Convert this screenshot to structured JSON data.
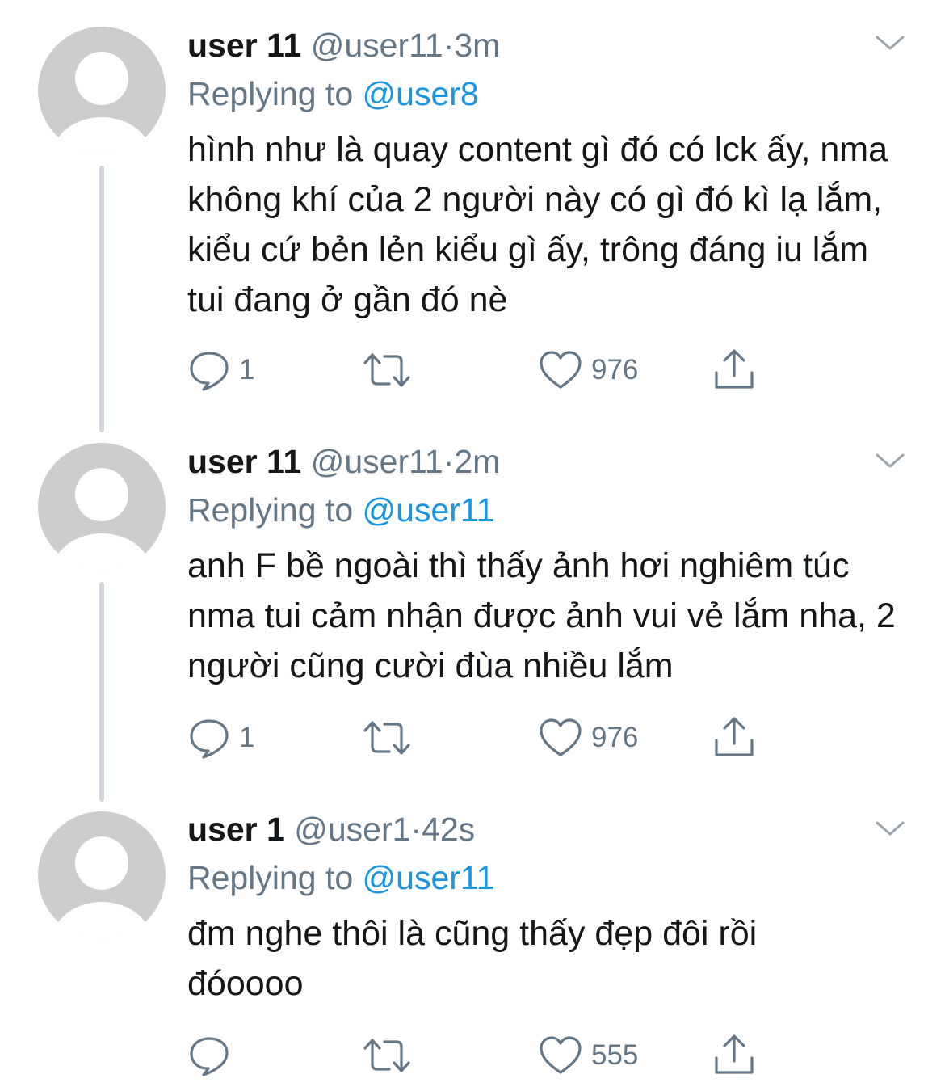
{
  "tweets": [
    {
      "name": "user 11",
      "handle": "@user11",
      "dot": "·",
      "time": "3m",
      "replying_prefix": "Replying to",
      "replying_to": "@user8",
      "text": "hình như là quay content gì đó có lck ấy, nma không khí của 2 người này có gì đó kì lạ lắm, kiểu cứ bẻn lẻn kiểu gì ấy, trông đáng iu lắm tui đang ở gần đó nè",
      "replies": "1",
      "retweets": "",
      "likes": "976"
    },
    {
      "name": "user 11",
      "handle": "@user11",
      "dot": "·",
      "time": "2m",
      "replying_prefix": "Replying to",
      "replying_to": "@user11",
      "text": "anh F bề ngoài thì thấy ảnh hơi nghiêm túc nma tui cảm nhận được ảnh vui vẻ lắm nha, 2 người cũng cười đùa nhiều lắm",
      "replies": "1",
      "retweets": "",
      "likes": "976"
    },
    {
      "name": "user 1",
      "handle": "@user1",
      "dot": "·",
      "time": "42s",
      "replying_prefix": "Replying to",
      "replying_to": "@user11",
      "text": "đm nghe thôi là cũng thấy đẹp đôi rồi đóoooo",
      "replies": "",
      "retweets": "",
      "likes": "555"
    }
  ],
  "icons": {
    "reply": "reply-icon",
    "retweet": "retweet-icon",
    "like": "like-icon",
    "share": "share-icon",
    "more": "chevron-down-icon",
    "avatar": "default-avatar-icon"
  },
  "colors": {
    "text": "#14171a",
    "secondary": "#657786",
    "link": "#1b95e0",
    "avatar_bg": "#cdcdcd",
    "thread_line": "#cfd6dc"
  }
}
